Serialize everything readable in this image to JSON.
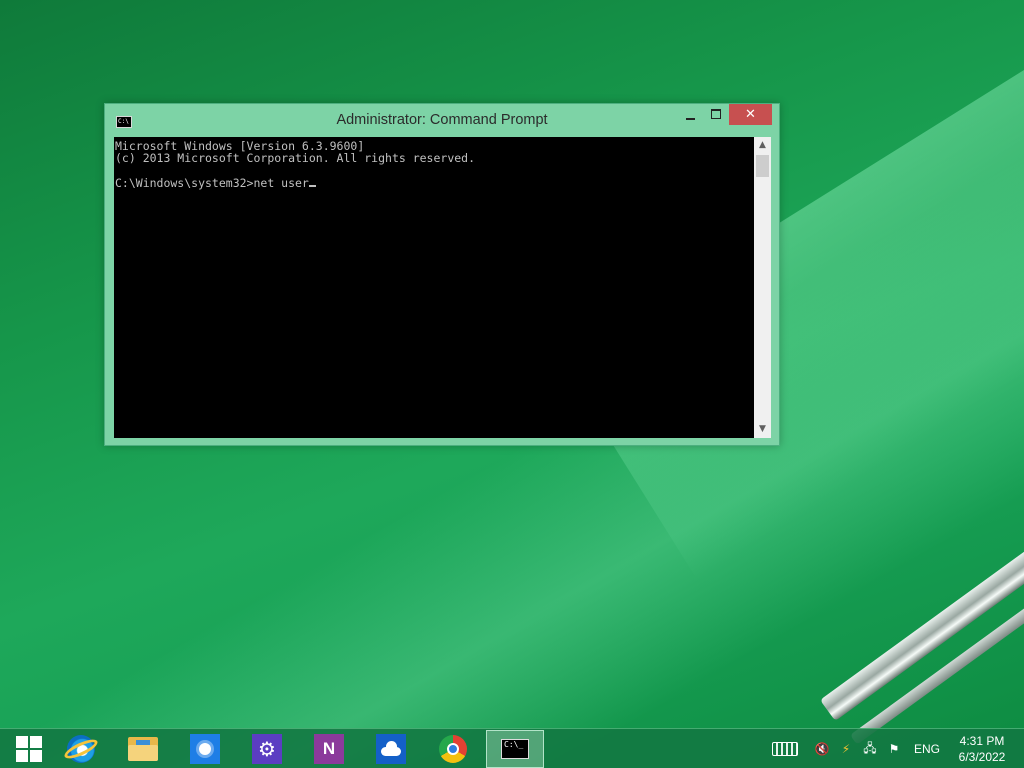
{
  "window": {
    "title": "Administrator: Command Prompt",
    "icon": "cmd-icon",
    "controls": {
      "minimize": "minimize",
      "maximize": "maximize",
      "close": "✕"
    }
  },
  "console": {
    "lines": [
      "Microsoft Windows [Version 6.3.9600]",
      "(c) 2013 Microsoft Corporation. All rights reserved.",
      "",
      "C:\\Windows\\system32>net user"
    ]
  },
  "taskbar": {
    "apps": [
      {
        "name": "start",
        "icon": "windows-logo-icon"
      },
      {
        "name": "internet-explorer",
        "icon": "internet-explorer-icon"
      },
      {
        "name": "file-explorer",
        "icon": "folder-icon"
      },
      {
        "name": "weather",
        "icon": "sun-icon"
      },
      {
        "name": "settings",
        "icon": "gear-icon"
      },
      {
        "name": "onenote",
        "icon": "onenote-icon",
        "glyph": "N"
      },
      {
        "name": "onedrive",
        "icon": "cloud-icon"
      },
      {
        "name": "chrome",
        "icon": "chrome-icon"
      },
      {
        "name": "command-prompt",
        "icon": "cmd-icon",
        "active": true
      }
    ],
    "tray": {
      "language": "ENG",
      "time": "4:31 PM",
      "date": "6/3/2022"
    }
  },
  "colors": {
    "desktop": "#16964a",
    "window_frame": "#7dd3a6",
    "close_button": "#c75050",
    "console_bg": "#000000",
    "console_text": "#c0c0c0"
  }
}
